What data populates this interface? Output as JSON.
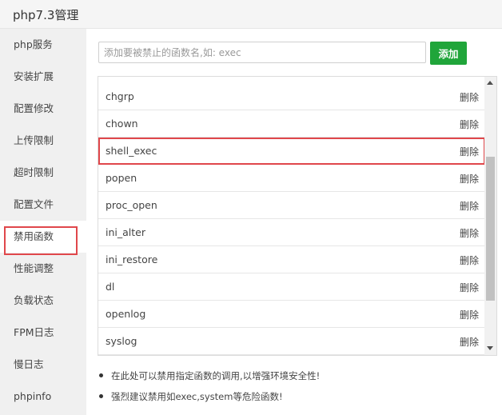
{
  "window": {
    "title": "php7.3管理"
  },
  "sidebar": {
    "items": [
      {
        "label": "php服务"
      },
      {
        "label": "安装扩展"
      },
      {
        "label": "配置修改"
      },
      {
        "label": "上传限制"
      },
      {
        "label": "超时限制"
      },
      {
        "label": "配置文件"
      },
      {
        "label": "禁用函数"
      },
      {
        "label": "性能调整"
      },
      {
        "label": "负载状态"
      },
      {
        "label": "FPM日志"
      },
      {
        "label": "慢日志"
      },
      {
        "label": "phpinfo"
      }
    ],
    "active": "禁用函数"
  },
  "toolbar": {
    "input_placeholder": "添加要被禁止的函数名,如: exec",
    "input_value": "",
    "add_label": "添加"
  },
  "functions": {
    "delete_label": "删除",
    "rows": [
      "chgrp",
      "chown",
      "shell_exec",
      "popen",
      "proc_open",
      "ini_alter",
      "ini_restore",
      "dl",
      "openlog",
      "syslog"
    ],
    "highlighted": "shell_exec"
  },
  "tips": [
    "在此处可以禁用指定函数的调用,以增强环境安全性!",
    "强烈建议禁用如exec,system等危险函数!"
  ],
  "colors": {
    "accent_green": "#20a53a",
    "highlight_red": "#e0474b"
  }
}
